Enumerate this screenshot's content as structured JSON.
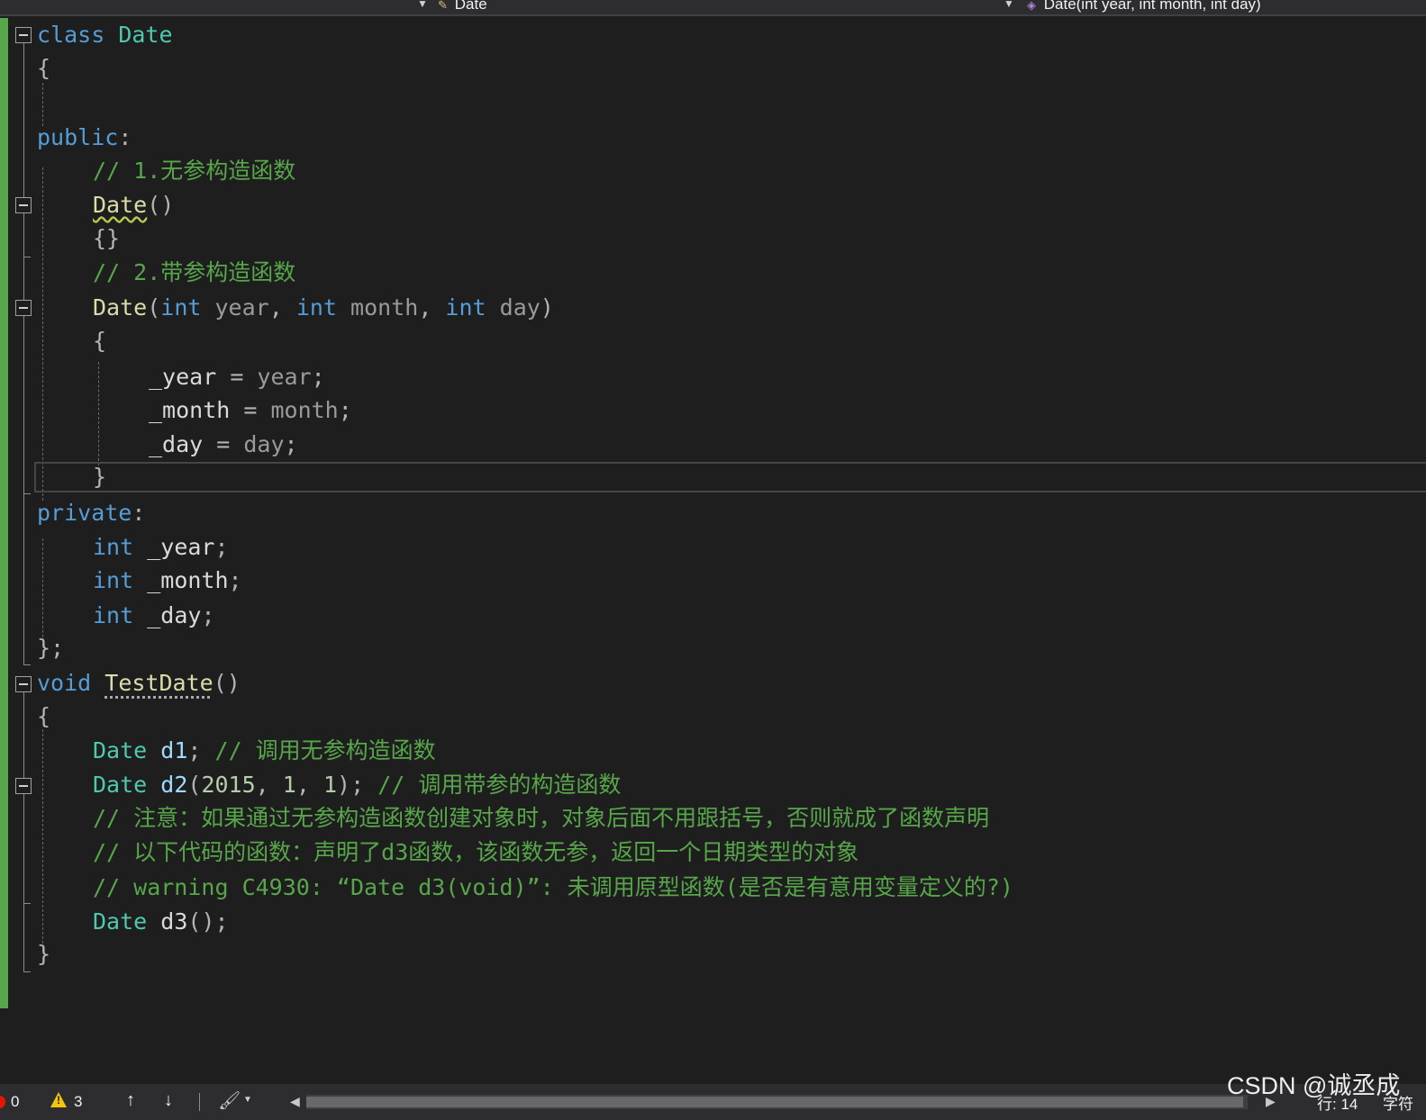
{
  "navbar": {
    "type_dropdown": "Date",
    "member_dropdown": "Date(int year, int month, int day)"
  },
  "editor": {
    "lines": {
      "l1": {
        "kw": "class",
        "name": "Date"
      },
      "l2": {
        "brace": "{"
      },
      "l4": {
        "kw": "public",
        "colon": ":"
      },
      "l5": {
        "comment": "// 1.无参构造函数"
      },
      "l6": {
        "fn": "Date",
        "parens": "()"
      },
      "l7": {
        "braces": "{}"
      },
      "l8": {
        "comment": "// 2.带参构造函数"
      },
      "l9": {
        "fn": "Date",
        "open": "(",
        "t1": "int",
        "p1": "year",
        "c1": ", ",
        "t2": "int",
        "p2": "month",
        "c2": ", ",
        "t3": "int",
        "p3": "day",
        "close": ")"
      },
      "l10": {
        "brace": "{"
      },
      "l11": {
        "field": "_year",
        "op": " = ",
        "param": "year",
        "semi": ";"
      },
      "l12": {
        "field": "_month",
        "op": " = ",
        "param": "month",
        "semi": ";"
      },
      "l13": {
        "field": "_day",
        "op": " = ",
        "param": "day",
        "semi": ";"
      },
      "l14": {
        "brace": "}"
      },
      "l15": {
        "kw": "private",
        "colon": ":"
      },
      "l16": {
        "type": "int",
        "field": "_year",
        "semi": ";"
      },
      "l17": {
        "type": "int",
        "field": "_month",
        "semi": ";"
      },
      "l18": {
        "type": "int",
        "field": "_day",
        "semi": ";"
      },
      "l19": {
        "brace": "};"
      },
      "l20": {
        "kw": "void",
        "fn": "TestDate",
        "parens": "()"
      },
      "l21": {
        "brace": "{"
      },
      "l22": {
        "type": "Date",
        "var": "d1",
        "semi": ";",
        "comment": "// 调用无参构造函数"
      },
      "l23": {
        "type": "Date",
        "var": "d2",
        "open": "(",
        "n1": "2015",
        "c1": ", ",
        "n2": "1",
        "c2": ", ",
        "n3": "1",
        "close": ");",
        "comment": "// 调用带参的构造函数"
      },
      "l24": {
        "comment": "// 注意：如果通过无参构造函数创建对象时，对象后面不用跟括号，否则就成了函数声明"
      },
      "l25": {
        "comment": "// 以下代码的函数：声明了d3函数，该函数无参，返回一个日期类型的对象"
      },
      "l26": {
        "comment": "// warning C4930: “Date d3(void)”: 未调用原型函数(是否是有意用变量定义的?)"
      },
      "l27": {
        "type": "Date",
        "var": "d3",
        "tail": "();"
      },
      "l28": {
        "brace": "}"
      }
    }
  },
  "statusbar": {
    "errors": "0",
    "warnings": "3",
    "up_arrow": "↑",
    "down_arrow": "↓",
    "cursor_line": "行: 14",
    "cursor_col": "字符"
  },
  "watermark": "CSDN @诚丞成",
  "colors": {
    "background": "#1e1e1e",
    "keyword": "#569cd6",
    "type": "#4ec9b0",
    "function": "#dcdcaa",
    "comment": "#57a64a",
    "number": "#b5cea8",
    "change_bar": "#57a64a"
  }
}
